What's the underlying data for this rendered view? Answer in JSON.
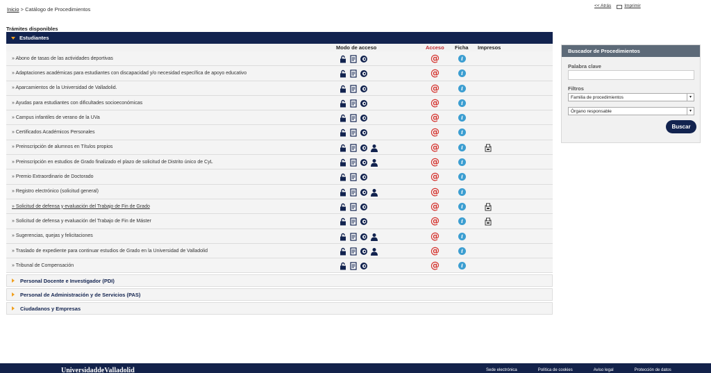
{
  "breadcrumb": {
    "home": "Inicio",
    "sep": " > ",
    "current": "Catálogo de Procedimientos"
  },
  "top_links": {
    "back": "<< Atrás",
    "print": "Imprimir"
  },
  "section_title": "Trámites disponibles",
  "estudiantes": {
    "title": "Estudiantes",
    "columns": {
      "modo": "Modo de acceso",
      "acceso": "Acceso",
      "ficha": "Ficha",
      "impresos": "Impresos"
    },
    "rows": [
      {
        "label": "Abono de tasas de las actividades deportivas",
        "person": false,
        "impreso": false
      },
      {
        "label": "Adaptaciones académicas para estudiantes con discapacidad y/o necesidad específica de apoyo educativo",
        "person": false,
        "impreso": false
      },
      {
        "label": "Aparcamientos de la Universidad de Valladolid.",
        "person": false,
        "impreso": false
      },
      {
        "label": "Ayudas para estudiantes con dificultades socioeconómicas",
        "person": false,
        "impreso": false
      },
      {
        "label": "Campus infantiles de verano de la UVa",
        "person": false,
        "impreso": false
      },
      {
        "label": "Certificados Académicos Personales",
        "person": false,
        "impreso": false
      },
      {
        "label": "Preinscripción de alumnos en Títulos propios",
        "person": true,
        "impreso": true
      },
      {
        "label": "Preinscripción en estudios de Grado finalizado el plazo de solicitud de Distrito único de CyL",
        "person": true,
        "impreso": false
      },
      {
        "label": "Premio Extraordinario de Doctorado",
        "person": false,
        "impreso": false
      },
      {
        "label": "Registro electrónico (solicitud general)",
        "person": true,
        "impreso": false
      },
      {
        "label": "Solicitud de defensa y evaluación del Trabajo de Fin de Grado",
        "person": false,
        "impreso": true
      },
      {
        "label": "Solicitud de defensa y evaluación del Trabajo de Fin de Máster",
        "person": false,
        "impreso": true
      },
      {
        "label": "Sugerencias, quejas y felicitaciones",
        "person": true,
        "impreso": false
      },
      {
        "label": "Traslado de expediente para continuar estudios de Grado en la Universidad de Valladolid",
        "person": true,
        "impreso": false
      },
      {
        "label": "Tribunal de Compensación",
        "person": false,
        "impreso": false
      }
    ]
  },
  "collapsed_sections": [
    "Personal Docente e Investigador (PDI)",
    "Personal de Administración y de Servicios (PAS)",
    "Ciudadanos y Empresas"
  ],
  "search": {
    "title": "Buscador de Procedimientos",
    "keyword_label": "Palabra clave",
    "keyword_value": "",
    "filters_label": "Filtros",
    "family_select": "Familia de procedimientos",
    "organ_select": "Órgano responsable",
    "button": "Buscar"
  },
  "footer": {
    "brand": "UniversidaddeValladolid",
    "links": [
      "Sede electrónica",
      "Política de cookies",
      "Aviso legal",
      "Protección de datos"
    ]
  },
  "colors": {
    "navy": "#12234f",
    "accent": "#f0a020",
    "at": "#d4332e",
    "info": "#3c9ed1"
  }
}
